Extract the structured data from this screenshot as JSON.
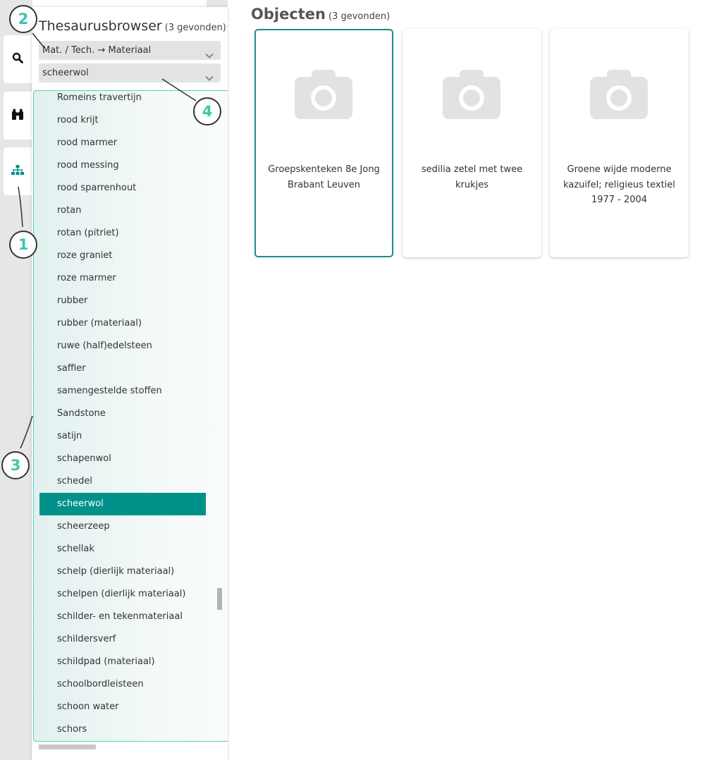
{
  "sidebar": {
    "tabs": [
      {
        "name": "search",
        "icon": "search-icon"
      },
      {
        "name": "binoculars",
        "icon": "binoculars-icon"
      },
      {
        "name": "thesaurus",
        "icon": "sitemap-icon"
      }
    ],
    "title": "Thesaurusbrowser",
    "count": "(3 gevonden)",
    "category_select": {
      "value": "Mat. / Tech. → Materiaal"
    },
    "term_select": {
      "value": "scheerwol"
    },
    "terms": [
      "Romeins travertijn",
      "rood krijt",
      "rood marmer",
      "rood messing",
      "rood sparrenhout",
      "rotan",
      "rotan (pitriet)",
      "roze graniet",
      "roze marmer",
      "rubber",
      "rubber (materiaal)",
      "ruwe (half)edelsteen",
      "saffier",
      "samengestelde stoffen",
      "Sandstone",
      "satijn",
      "schapenwol",
      "schedel",
      "scheerwol",
      "scheerzeep",
      "schellak",
      "schelp (dierlijk materiaal)",
      "schelpen (dierlijk materiaal)",
      "schilder- en tekenmateriaal",
      "schildersverf",
      "schildpad (materiaal)",
      "schoolbordleisteen",
      "schoon water",
      "schors"
    ],
    "selected_term": "scheerwol"
  },
  "callouts": [
    "1",
    "2",
    "3",
    "4"
  ],
  "main": {
    "title": "Objecten",
    "count": "(3 gevonden)",
    "cards": [
      {
        "caption": "Groepskenteken 8e Jong Brabant Leuven",
        "icon": "camera-icon"
      },
      {
        "caption": "sedilia zetel met twee krukjes",
        "icon": "camera-icon"
      },
      {
        "caption": "Groene wijde moderne kazuifel; religieus textiel 1977 - 2004",
        "icon": "camera-icon"
      }
    ]
  },
  "colors": {
    "accent": "#00918a",
    "highlight_border": "#55d0bf",
    "callout_text": "#3cc5b0",
    "placeholder_icon": "#e2e2e2"
  }
}
